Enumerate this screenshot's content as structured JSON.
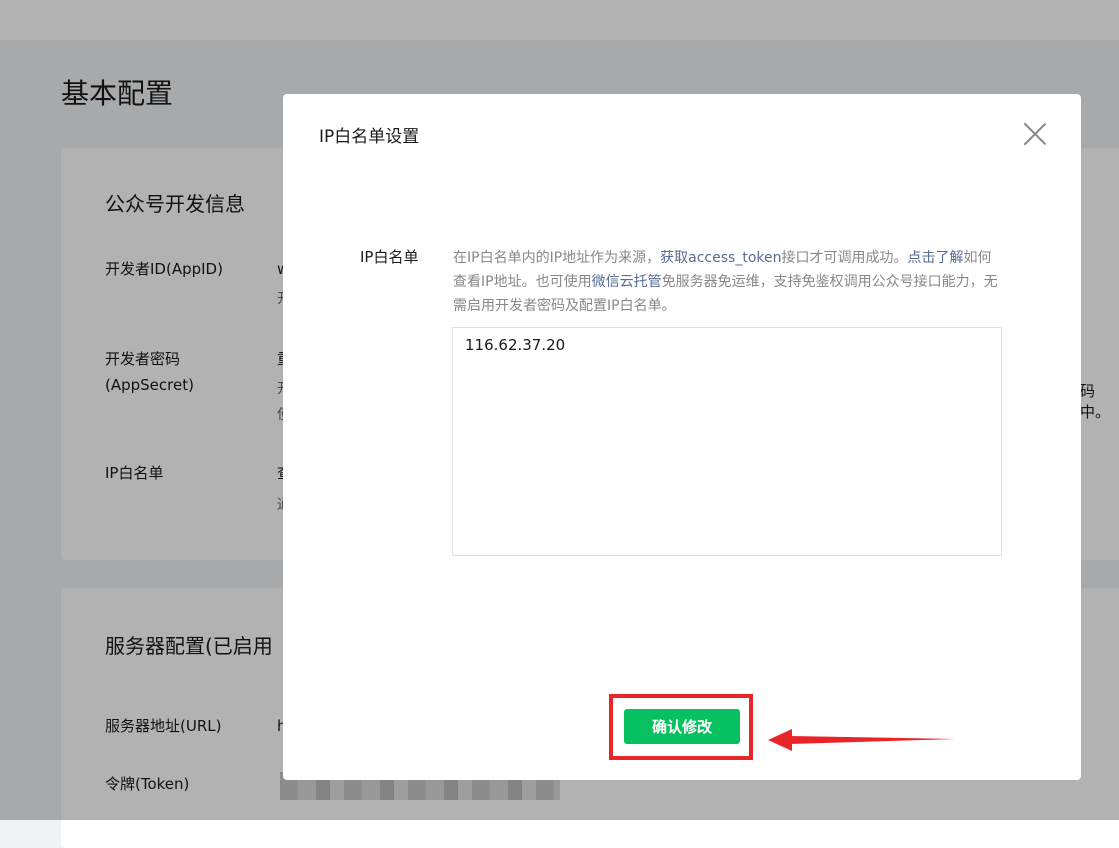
{
  "page": {
    "title": "基本配置"
  },
  "developer_info": {
    "title": "公众号开发信息",
    "rows": [
      {
        "label": "开发者ID(AppID)",
        "value": "w",
        "sub": "开"
      },
      {
        "label": "开发者密码(AppSecret)",
        "value": "重",
        "sub": "开",
        "sub2": "使",
        "right_clip": "码中。"
      },
      {
        "label": "IP白名单",
        "value": "查",
        "sub": "通"
      }
    ]
  },
  "server_config": {
    "title": "服务器配置(已启用",
    "rows": [
      {
        "label": "服务器地址(URL)",
        "value": "h"
      },
      {
        "label": "令牌(Token)",
        "value": ""
      }
    ]
  },
  "dialog": {
    "title": "IP白名单设置",
    "field_label": "IP白名单",
    "desc_part1": "在IP白名单内的IP地址作为来源，",
    "desc_link1": "获取access_token",
    "desc_part2": "接口才可调用成功。",
    "desc_link2": "点击了解",
    "desc_part3": "如何查看IP地址。也可使用",
    "desc_link3": "微信云托管",
    "desc_part4": "免服务器免运维，支持免鉴权调用公众号接口能力，无需启用开发者密码及配置IP白名单。",
    "ip_value": "116.62.37.20",
    "confirm_label": "确认修改"
  },
  "colors": {
    "primary": "#07c160",
    "link": "#576b95",
    "annotation": "#e8262a"
  }
}
